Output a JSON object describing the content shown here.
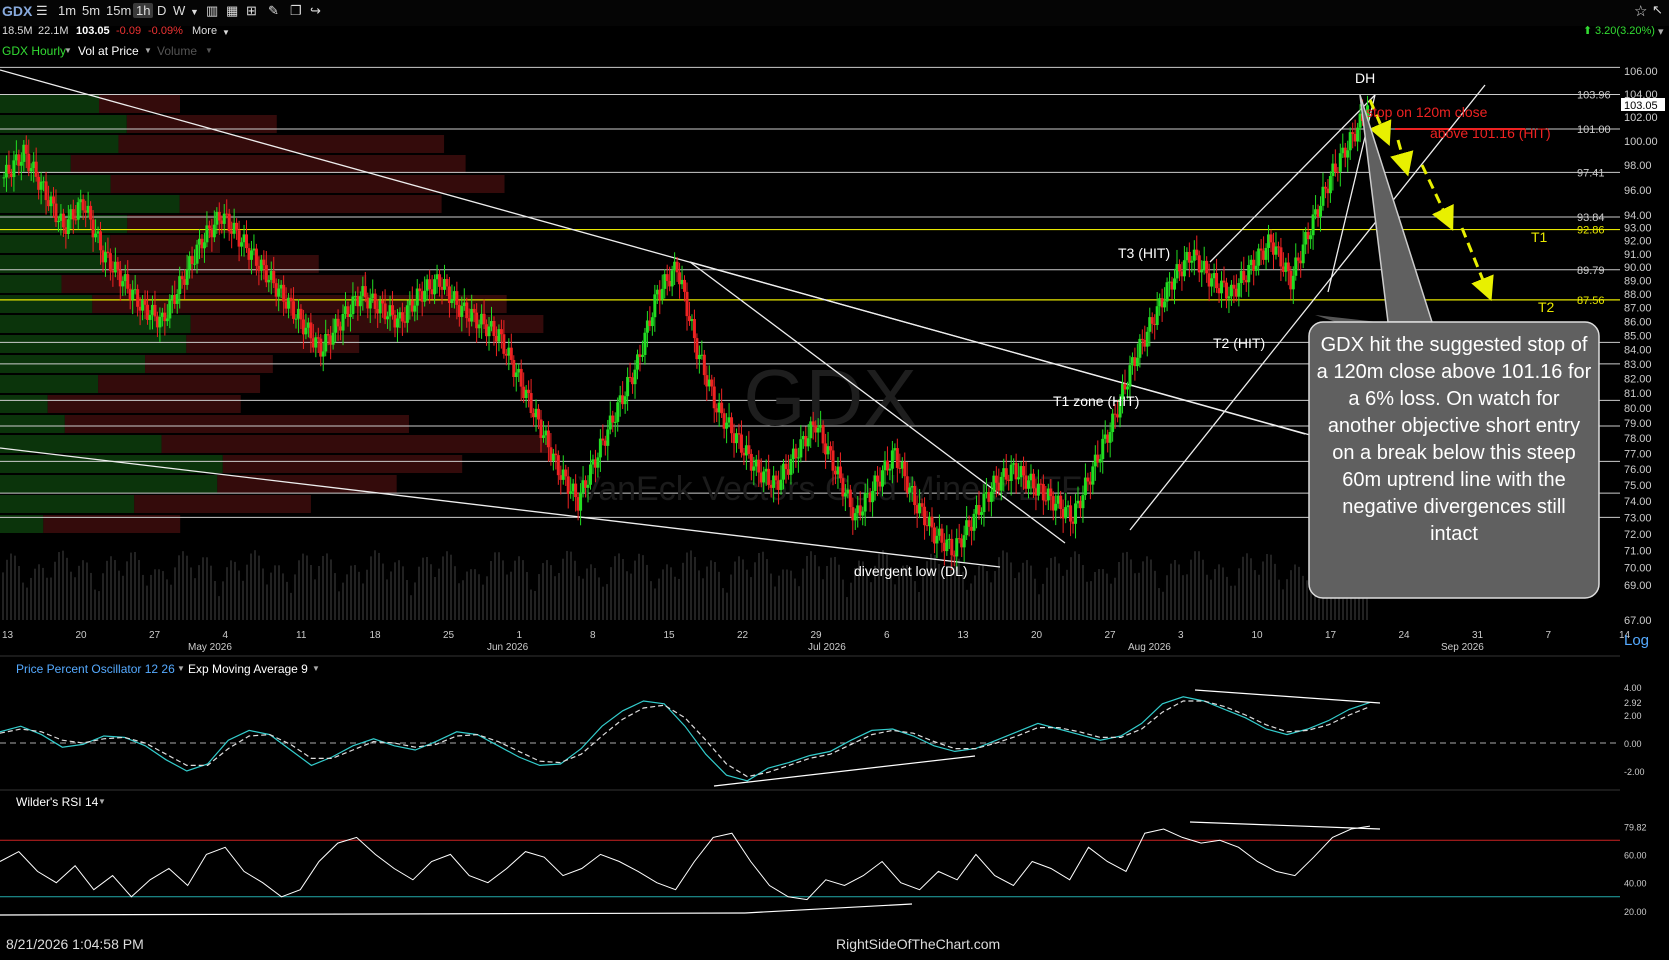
{
  "toolbar": {
    "ticker": "GDX",
    "intervals": [
      "1m",
      "5m",
      "15m",
      "1h",
      "D",
      "W"
    ],
    "active_interval": "1h"
  },
  "info": {
    "vol1": "18.5M",
    "vol2": "22.1M",
    "last": "103.05",
    "change": "-0.09",
    "change_pct": "-0.09%",
    "more": "More",
    "day_change": "3.20(3.20%)"
  },
  "legend": {
    "main": "GDX Hourly",
    "vol_at_price": "Vol at Price",
    "volume": "Volume",
    "ppo": "Price Percent Oscillator 12 26",
    "ema": "Exp Moving Average 9",
    "rsi": "Wilder's RSI 14",
    "log": "Log"
  },
  "watermark": {
    "symbol": "GDX",
    "name": "VanEck Vectors Gold Miners ETF"
  },
  "colors": {
    "up": "#22dd22",
    "down": "#ee2222",
    "hline": "#cccccc",
    "yellow_line": "#e8e800",
    "arrow": "#e8f000",
    "ppo_line": "#3cc",
    "rsi_line": "#ffffff"
  },
  "annotations": {
    "dh": "DH",
    "stop": "stop on 120m close",
    "stop2": "above 101.16 (HIT)",
    "t1": "T1",
    "t2": "T2",
    "t3": "T3 (HIT)",
    "t2hit": "T2 (HIT)",
    "t1zone": "T1 zone (HIT)",
    "divergent": "divergent low (DL)",
    "callout": "GDX hit the suggested stop of a 120m close above 101.16 for a 6% loss. On watch for another objective short entry on a break below this steep 60m uptrend line with the negative divergences still intact"
  },
  "chart_data": [
    {
      "type": "candlestick",
      "title": "GDX Hourly",
      "ylim": [
        67,
        107
      ],
      "log_scale": true,
      "y_ticks": [
        67,
        69,
        70,
        71,
        72,
        73,
        74,
        75,
        76,
        77,
        78,
        79,
        80,
        81,
        82,
        83,
        84,
        85,
        86,
        87,
        88,
        89,
        90,
        91,
        92,
        93,
        94,
        96,
        98,
        100,
        102,
        104,
        106
      ],
      "price_labels": [
        "103.96",
        "101.00",
        "97.41",
        "93.84",
        "92.86",
        "89.79",
        "87.56"
      ],
      "current_price": "103.05",
      "horizontal_levels": [
        106.34,
        103.96,
        101.0,
        97.41,
        93.84,
        89.79,
        84.5,
        83.0,
        80.5,
        78.8,
        76.5,
        74.5,
        73.0
      ],
      "yellow_levels": [
        92.86,
        87.56
      ],
      "x_tick_labels": [
        "13",
        "20",
        "27",
        "4",
        "11",
        "18",
        "25",
        "1",
        "8",
        "15",
        "22",
        "29",
        "6",
        "13",
        "20",
        "27",
        "3",
        "10",
        "17",
        "24",
        "31",
        "7",
        "14"
      ],
      "month_labels": [
        "May 2026",
        "Jun 2026",
        "Jul 2026",
        "Aug 2026",
        "Sep 2026"
      ],
      "price_path": [
        [
          0,
          97
        ],
        [
          2,
          99
        ],
        [
          4,
          96
        ],
        [
          6,
          93
        ],
        [
          8,
          95
        ],
        [
          10,
          91
        ],
        [
          12,
          89
        ],
        [
          14,
          87
        ],
        [
          16,
          86
        ],
        [
          18,
          89
        ],
        [
          20,
          92
        ],
        [
          22,
          94
        ],
        [
          24,
          92
        ],
        [
          26,
          90
        ],
        [
          28,
          88
        ],
        [
          30,
          86
        ],
        [
          32,
          84
        ],
        [
          34,
          86
        ],
        [
          36,
          88
        ],
        [
          38,
          87
        ],
        [
          40,
          86
        ],
        [
          42,
          88
        ],
        [
          44,
          89
        ],
        [
          46,
          87
        ],
        [
          48,
          86
        ],
        [
          50,
          85
        ],
        [
          52,
          82
        ],
        [
          54,
          79
        ],
        [
          56,
          76
        ],
        [
          58,
          74
        ],
        [
          60,
          77
        ],
        [
          62,
          80
        ],
        [
          64,
          83
        ],
        [
          66,
          88
        ],
        [
          68,
          90
        ],
        [
          70,
          84
        ],
        [
          72,
          80
        ],
        [
          74,
          78
        ],
        [
          76,
          76
        ],
        [
          78,
          75
        ],
        [
          80,
          77
        ],
        [
          82,
          79
        ],
        [
          84,
          76
        ],
        [
          86,
          73
        ],
        [
          88,
          75
        ],
        [
          90,
          77
        ],
        [
          92,
          74
        ],
        [
          94,
          72
        ],
        [
          96,
          71
        ],
        [
          98,
          73
        ],
        [
          100,
          75
        ],
        [
          102,
          76
        ],
        [
          104,
          75
        ],
        [
          106,
          74
        ],
        [
          108,
          73
        ],
        [
          110,
          76
        ],
        [
          112,
          79
        ],
        [
          114,
          83
        ],
        [
          116,
          86
        ],
        [
          118,
          89
        ],
        [
          120,
          91
        ],
        [
          122,
          89
        ],
        [
          124,
          88
        ],
        [
          126,
          90
        ],
        [
          128,
          92
        ],
        [
          130,
          89
        ],
        [
          132,
          93
        ],
        [
          134,
          97
        ],
        [
          136,
          100
        ],
        [
          138,
          103
        ]
      ]
    },
    {
      "type": "line",
      "title": "Price Percent Oscillator 12 26",
      "ylim": [
        -3,
        4.5
      ],
      "y_ticks": [
        "4.00",
        "2.92",
        "2.00",
        "0.00",
        "-2.00"
      ],
      "current": "2.92",
      "series": [
        {
          "name": "Price Percent Oscillator 12 26",
          "values": [
            0.8,
            1.2,
            0.6,
            -0.3,
            -0.1,
            0.5,
            0.4,
            -0.2,
            -1.2,
            -2.0,
            -1.5,
            0.2,
            0.9,
            0.6,
            -0.5,
            -1.6,
            -1.0,
            -0.2,
            0.3,
            -0.2,
            -0.5,
            0.1,
            0.8,
            0.6,
            -0.2,
            -1.0,
            -1.6,
            -1.5,
            -0.4,
            1.2,
            2.3,
            3.0,
            2.8,
            1.2,
            -0.8,
            -2.3,
            -2.7,
            -1.8,
            -1.4,
            -0.9,
            -0.6,
            0.2,
            0.9,
            1.0,
            0.5,
            -0.2,
            -0.6,
            -0.4,
            0.2,
            0.8,
            1.4,
            1.0,
            0.6,
            0.2,
            0.5,
            1.4,
            2.8,
            3.3,
            3.0,
            2.4,
            1.8,
            1.0,
            0.6,
            1.0,
            1.6,
            2.4,
            2.9
          ]
        },
        {
          "name": "Exp Moving Average 9",
          "values": [
            0.7,
            1.0,
            0.8,
            0.2,
            0.0,
            0.3,
            0.4,
            0.0,
            -0.8,
            -1.6,
            -1.6,
            -0.4,
            0.5,
            0.6,
            -0.1,
            -1.1,
            -1.1,
            -0.5,
            0.1,
            0.0,
            -0.3,
            -0.1,
            0.5,
            0.6,
            0.1,
            -0.6,
            -1.3,
            -1.4,
            -0.8,
            0.5,
            1.7,
            2.5,
            2.7,
            1.8,
            0.2,
            -1.5,
            -2.4,
            -2.1,
            -1.6,
            -1.1,
            -0.8,
            -0.1,
            0.6,
            0.9,
            0.7,
            0.1,
            -0.4,
            -0.4,
            0.0,
            0.5,
            1.1,
            1.1,
            0.8,
            0.4,
            0.4,
            1.0,
            2.2,
            3.0,
            3.0,
            2.6,
            2.0,
            1.3,
            0.8,
            0.9,
            1.3,
            2.0,
            2.6
          ]
        }
      ]
    },
    {
      "type": "line",
      "title": "Wilder's RSI 14",
      "ylim": [
        15,
        90
      ],
      "y_ticks": [
        "79.82",
        "60.00",
        "40.00",
        "20.00"
      ],
      "current": "79.82",
      "overbought": 70,
      "oversold": 30,
      "series": [
        {
          "name": "Wilder's RSI 14",
          "values": [
            55,
            62,
            48,
            40,
            52,
            35,
            45,
            30,
            42,
            50,
            38,
            60,
            65,
            48,
            40,
            30,
            35,
            55,
            68,
            72,
            60,
            50,
            42,
            55,
            60,
            45,
            40,
            50,
            62,
            58,
            45,
            50,
            60,
            55,
            48,
            40,
            35,
            55,
            72,
            75,
            55,
            38,
            30,
            28,
            42,
            38,
            45,
            55,
            40,
            35,
            48,
            42,
            60,
            45,
            38,
            55,
            50,
            42,
            65,
            55,
            48,
            75,
            78,
            72,
            68,
            70,
            65,
            55,
            48,
            45,
            58,
            72,
            78,
            80
          ]
        }
      ]
    }
  ]
}
